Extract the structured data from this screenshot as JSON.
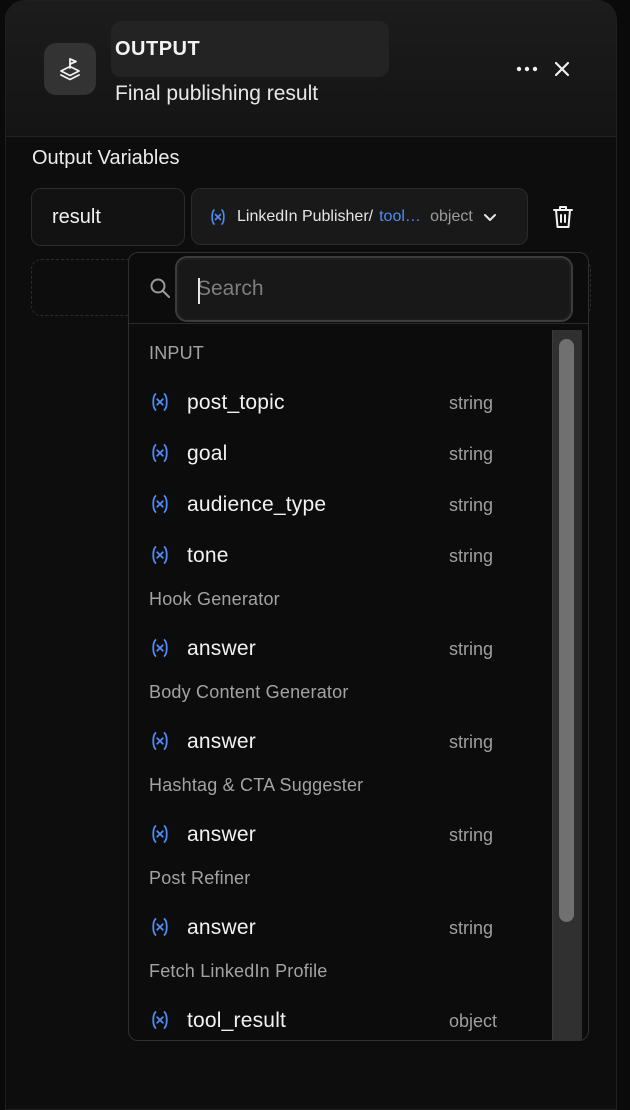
{
  "node": {
    "title": "OUTPUT",
    "subtitle": "Final publishing result",
    "icon": "flag-stack-icon"
  },
  "output_section": {
    "label": "Output Variables",
    "variable_name": "result",
    "selected_source": "LinkedIn Publisher/",
    "selected_field": "tool_result",
    "selected_type": "object"
  },
  "dropdown": {
    "search_placeholder": "Search",
    "groups": [
      {
        "name": "INPUT",
        "items": [
          {
            "name": "post_topic",
            "type": "string"
          },
          {
            "name": "goal",
            "type": "string"
          },
          {
            "name": "audience_type",
            "type": "string"
          },
          {
            "name": "tone",
            "type": "string"
          }
        ]
      },
      {
        "name": "Hook Generator",
        "items": [
          {
            "name": "answer",
            "type": "string"
          }
        ]
      },
      {
        "name": "Body Content Generator",
        "items": [
          {
            "name": "answer",
            "type": "string"
          }
        ]
      },
      {
        "name": "Hashtag & CTA Suggester",
        "items": [
          {
            "name": "answer",
            "type": "string"
          }
        ]
      },
      {
        "name": "Post Refiner",
        "items": [
          {
            "name": "answer",
            "type": "string"
          }
        ]
      },
      {
        "name": "Fetch LinkedIn Profile",
        "items": [
          {
            "name": "tool_result",
            "type": "object"
          }
        ]
      }
    ]
  },
  "colors": {
    "accent": "#4f8cf7",
    "background": "#0d0d0d",
    "header": "#1c1c1c"
  }
}
